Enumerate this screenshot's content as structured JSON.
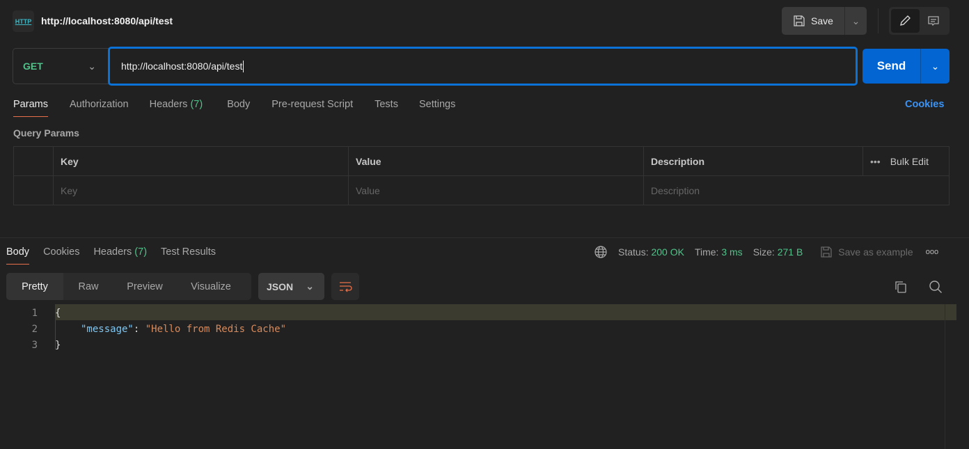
{
  "header": {
    "icon_text": "HTTP",
    "title": "http://localhost:8080/api/test",
    "save_label": "Save"
  },
  "request": {
    "method": "GET",
    "url": "http://localhost:8080/api/test",
    "send_label": "Send"
  },
  "req_tabs": [
    {
      "label": "Params"
    },
    {
      "label": "Authorization"
    },
    {
      "label": "Headers",
      "count": "(7)"
    },
    {
      "label": "Body"
    },
    {
      "label": "Pre-request Script"
    },
    {
      "label": "Tests"
    },
    {
      "label": "Settings"
    }
  ],
  "cookies_label": "Cookies",
  "query_params": {
    "title": "Query Params",
    "headers": [
      "Key",
      "Value",
      "Description"
    ],
    "bulk_edit": "Bulk Edit",
    "placeholders": [
      "Key",
      "Value",
      "Description"
    ]
  },
  "resp_tabs": [
    {
      "label": "Body"
    },
    {
      "label": "Cookies"
    },
    {
      "label": "Headers",
      "count": "(7)"
    },
    {
      "label": "Test Results"
    }
  ],
  "response": {
    "status_label": "Status:",
    "status": "200 OK",
    "time_label": "Time:",
    "time": "3 ms",
    "size_label": "Size:",
    "size": "271 B",
    "save_example": "Save as example"
  },
  "format_tabs": [
    "Pretty",
    "Raw",
    "Preview",
    "Visualize"
  ],
  "language": "JSON",
  "code": {
    "line_numbers": [
      "1",
      "2",
      "3"
    ],
    "open": "{",
    "key": "\"message\"",
    "colon": ": ",
    "value": "\"Hello from Redis Cache\"",
    "close": "}"
  },
  "colors": {
    "accent": "#0265d2",
    "success": "#4fc48a",
    "tab_underline": "#e8704a"
  }
}
